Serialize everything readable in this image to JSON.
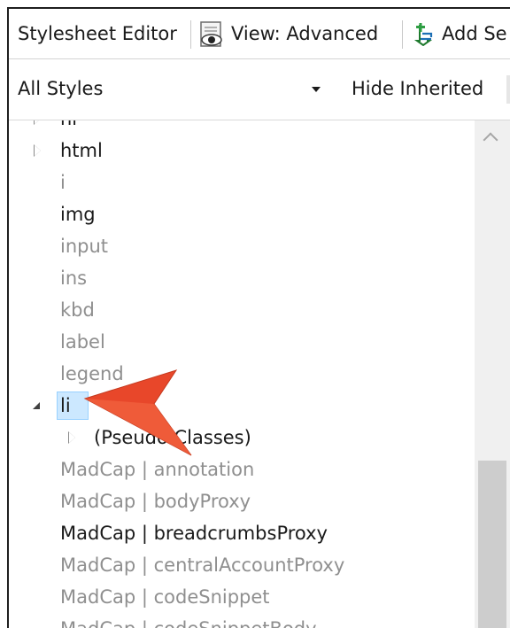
{
  "toolbar": {
    "title": "Stylesheet Editor",
    "view_label": "View: Advanced",
    "view_icon": "eye-icon",
    "add_label": "Add Se",
    "add_icon": "add-selector-icon"
  },
  "filter": {
    "selected": "All Styles",
    "hide_inherited_label": "Hide Inherited"
  },
  "tree": {
    "items": [
      {
        "label": "hr",
        "inherited": false,
        "expander": "closed"
      },
      {
        "label": "html",
        "inherited": false,
        "expander": "closed"
      },
      {
        "label": "i",
        "inherited": true,
        "expander": "none"
      },
      {
        "label": "img",
        "inherited": false,
        "expander": "none"
      },
      {
        "label": "input",
        "inherited": true,
        "expander": "none"
      },
      {
        "label": "ins",
        "inherited": true,
        "expander": "none"
      },
      {
        "label": "kbd",
        "inherited": true,
        "expander": "none"
      },
      {
        "label": "label",
        "inherited": true,
        "expander": "none"
      },
      {
        "label": "legend",
        "inherited": true,
        "expander": "none"
      },
      {
        "label": "li",
        "inherited": false,
        "expander": "open",
        "selected": true
      },
      {
        "label": "(Pseudo Classes)",
        "inherited": false,
        "expander": "closed",
        "child": true
      },
      {
        "label": "MadCap | annotation",
        "inherited": true,
        "expander": "none"
      },
      {
        "label": "MadCap | bodyProxy",
        "inherited": true,
        "expander": "none"
      },
      {
        "label": "MadCap | breadcrumbsProxy",
        "inherited": false,
        "expander": "none"
      },
      {
        "label": "MadCap | centralAccountProxy",
        "inherited": true,
        "expander": "none"
      },
      {
        "label": "MadCap | codeSnippet",
        "inherited": true,
        "expander": "none"
      },
      {
        "label": "MadCap | codeSnippetBody",
        "inherited": true,
        "expander": "none"
      }
    ]
  },
  "colors": {
    "accent_arrow": "#e8472a",
    "selection": "#cce8ff",
    "inherited_text": "#8f8f8f",
    "text": "#1a1a1a"
  }
}
